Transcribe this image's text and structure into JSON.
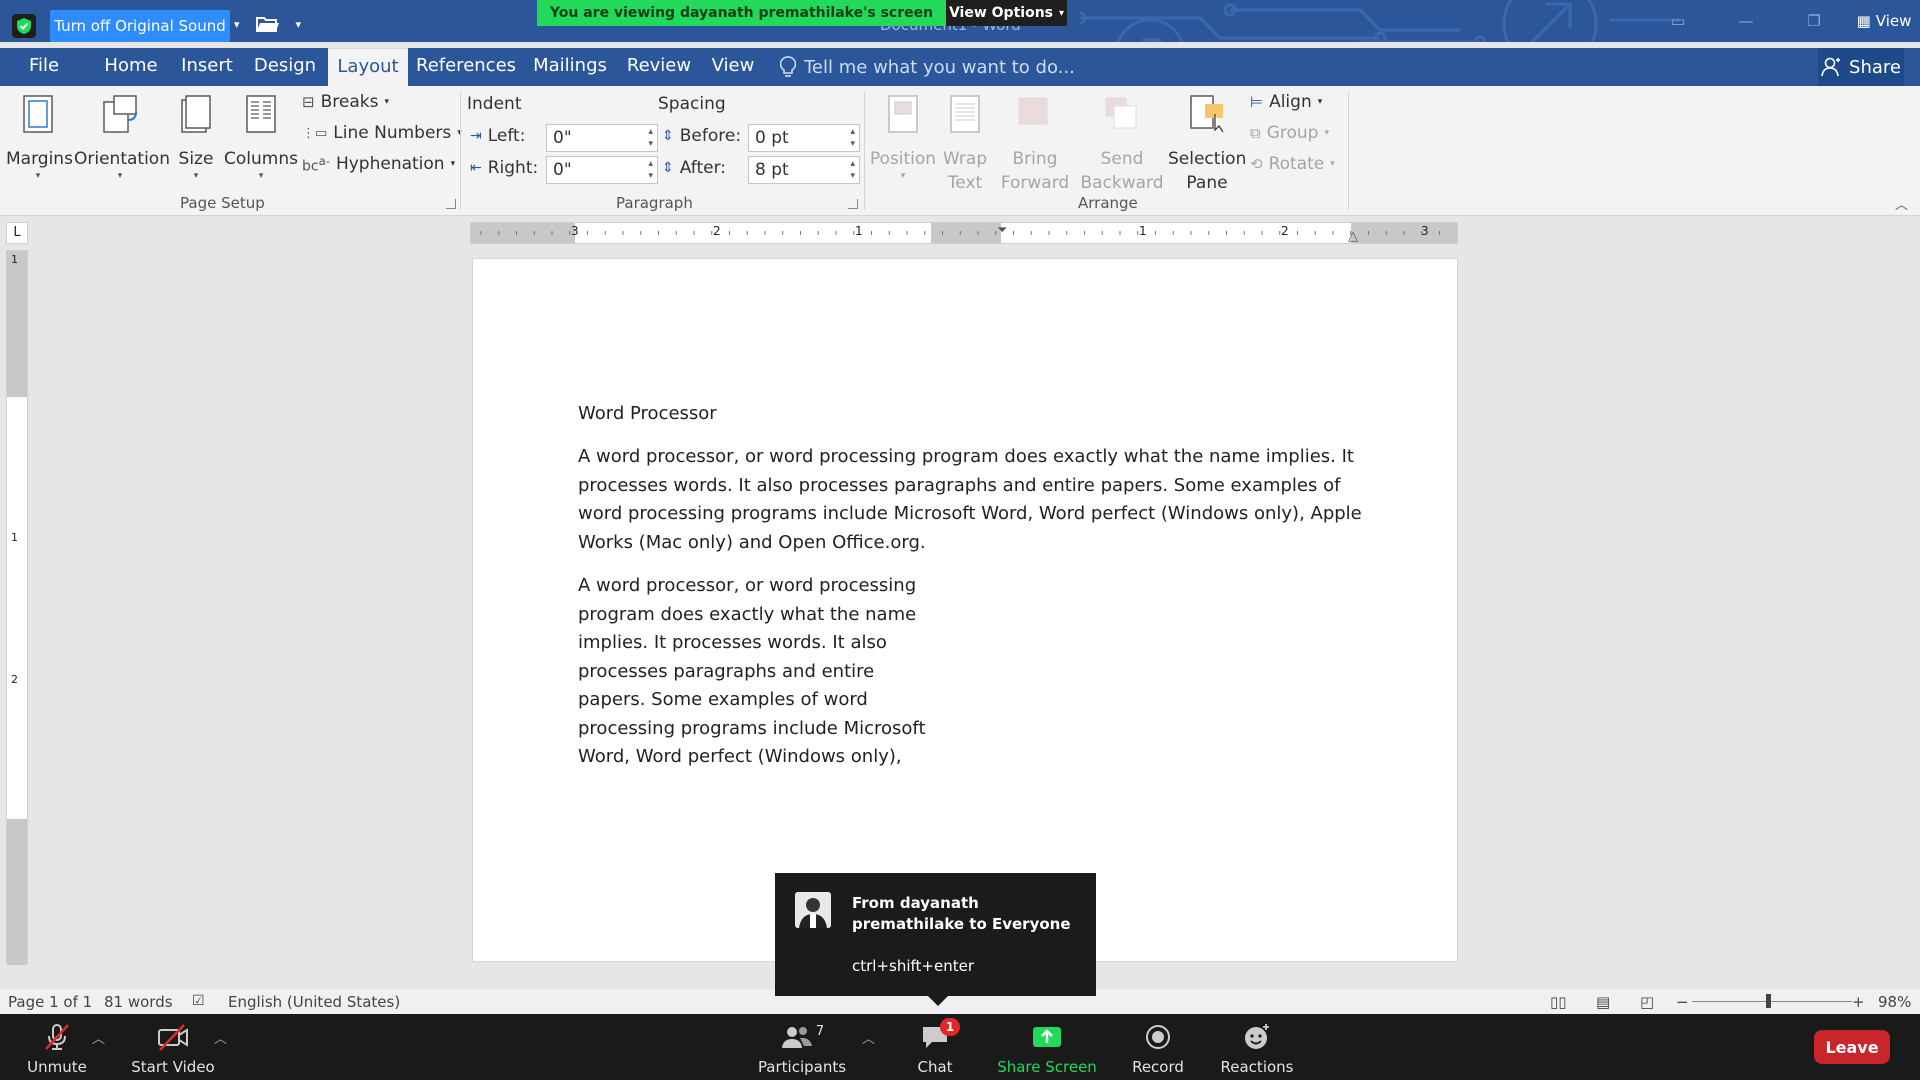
{
  "titlebar": {
    "original_sound": "Turn off Original Sound",
    "viewing_banner": "You are viewing dayanath premathilake's screen",
    "view_options": "View Options",
    "doc_title": "Document1 - Word",
    "view_btn": "View"
  },
  "menu": {
    "tabs": [
      "File",
      "Home",
      "Insert",
      "Design",
      "Layout",
      "References",
      "Mailings",
      "Review",
      "View"
    ],
    "active": "Layout",
    "tellme": "Tell me what you want to do...",
    "share": "Share"
  },
  "ribbon": {
    "page_setup": {
      "margins": "Margins",
      "orientation": "Orientation",
      "size": "Size",
      "columns": "Columns",
      "breaks": "Breaks",
      "line_numbers": "Line Numbers",
      "hyphenation": "Hyphenation",
      "group_label": "Page Setup"
    },
    "paragraph": {
      "indent_title": "Indent",
      "spacing_title": "Spacing",
      "left_label": "Left:",
      "right_label": "Right:",
      "before_label": "Before:",
      "after_label": "After:",
      "left_value": "0\"",
      "right_value": "0\"",
      "before_value": "0 pt",
      "after_value": "8 pt",
      "group_label": "Paragraph"
    },
    "arrange": {
      "position": "Position",
      "wrap1": "Wrap",
      "wrap2": "Text",
      "bring1": "Bring",
      "bring2": "Forward",
      "send1": "Send",
      "send2": "Backward",
      "sel1": "Selection",
      "sel2": "Pane",
      "align": "Align",
      "group": "Group",
      "rotate": "Rotate",
      "group_label": "Arrange"
    }
  },
  "ruler": {
    "h_labels": [
      "3",
      "2",
      "1",
      "1",
      "2",
      "3"
    ],
    "v_labels": [
      "1",
      "1",
      "2"
    ]
  },
  "document": {
    "heading": "Word Processor",
    "para1": " A word processor, or word processing program does exactly what the name implies. It processes words. It also processes paragraphs and entire papers. Some examples of word processing programs include Microsoft Word, Word perfect (Windows only), Apple Works (Mac only) and Open Office.org.",
    "para2": "A word processor, or word processing program does exactly what the name implies. It processes words. It also processes paragraphs and entire papers. Some examples of word processing programs include Microsoft Word, Word perfect (Windows only),"
  },
  "statusbar": {
    "page": "Page 1 of 1",
    "words": "81 words",
    "language": "English (United States)",
    "zoom": "98%",
    "zoom_minus": "−",
    "zoom_plus": "+"
  },
  "chat_popup": {
    "from": "From dayanath premathilake to Everyone",
    "message": "ctrl+shift+enter"
  },
  "zoom_controls": {
    "unmute": "Unmute",
    "start_video": "Start Video",
    "participants": "Participants",
    "participants_count": "7",
    "chat": "Chat",
    "chat_badge": "1",
    "share_screen": "Share Screen",
    "record": "Record",
    "reactions": "Reactions",
    "leave": "Leave"
  },
  "colors": {
    "word_blue": "#2b579a",
    "zoom_green": "#23d959",
    "zoom_blue": "#2d8cff",
    "leave_red": "#c8262a"
  }
}
